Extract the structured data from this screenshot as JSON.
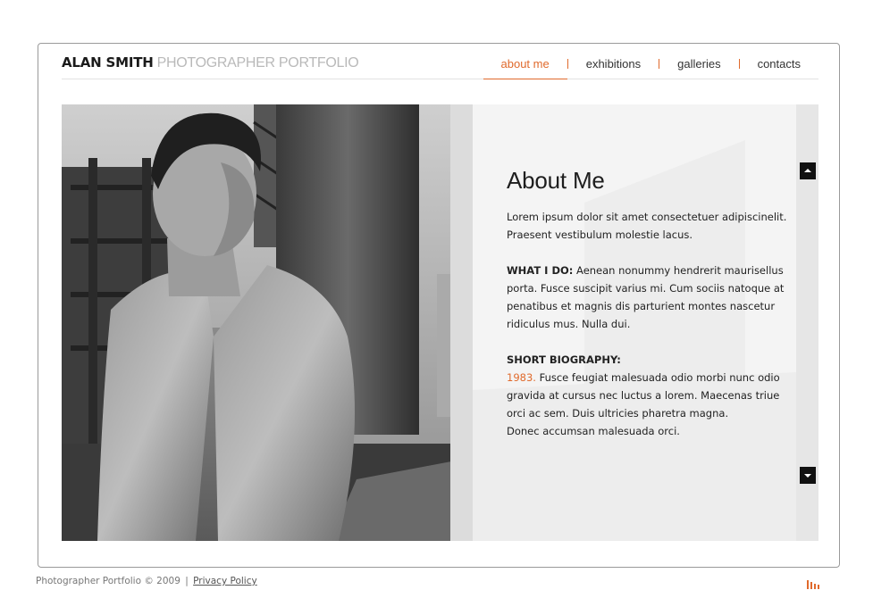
{
  "brand": {
    "name": "ALAN SMITH",
    "tagline": "PHOTOGRAPHER PORTFOLIO"
  },
  "nav": {
    "items": [
      "about me",
      "exhibitions",
      "galleries",
      "contacts"
    ],
    "active": "about me"
  },
  "photo": {
    "icon": "portrait-photo"
  },
  "about": {
    "title": "About Me",
    "intro": "Lorem ipsum dolor sit amet consectetuer adipiscinelit. Praesent vestibulum molestie lacus.",
    "what_label": "WHAT I DO:",
    "what_text": "Aenean nonummy hendrerit maurisellus porta. Fusce suscipit varius mi. Cum sociis natoque at penatibus et magnis dis parturient montes nascetur ridiculus mus. Nulla dui.",
    "bio_label": "SHORT BIOGRAPHY:",
    "bio_year": "1983.",
    "bio_text": "Fusce feugiat malesuada odio morbi nunc odio gravida at cursus nec luctus a lorem. Maecenas triue orci ac sem. Duis ultricies pharetra magna.",
    "bio_text2": "Donec accumsan malesuada orci."
  },
  "scroll": {
    "up_icon": "arrow-up-icon",
    "down_icon": "arrow-down-icon"
  },
  "footer": {
    "copyright": "Photographer Portfolio © 2009",
    "sep": "|",
    "privacy": "Privacy Policy"
  },
  "colors": {
    "accent": "#e06a2c",
    "text": "#222222",
    "frame": "#9a9a9a"
  }
}
